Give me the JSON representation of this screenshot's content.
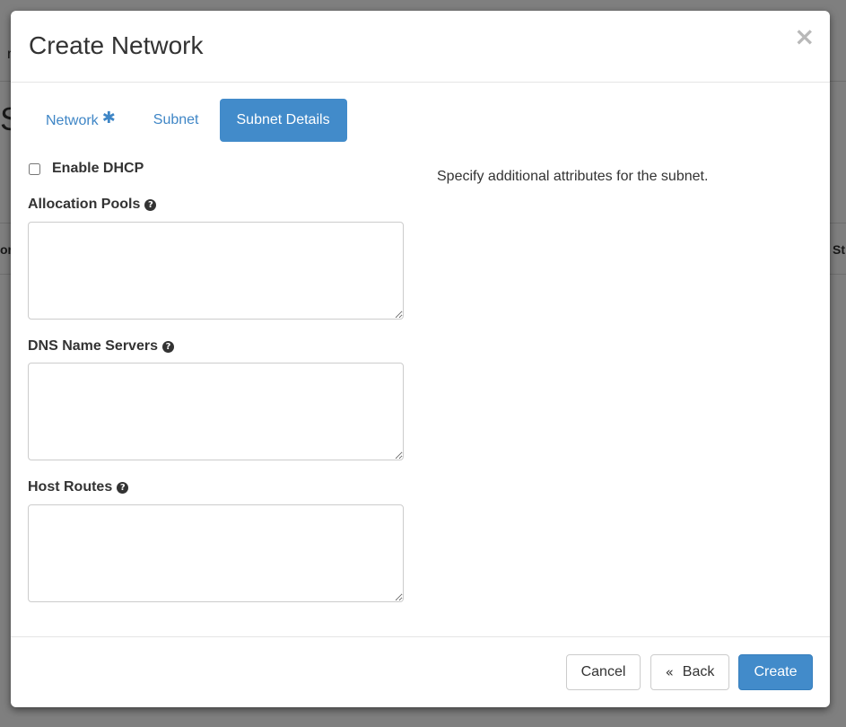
{
  "background": {
    "heading_fragment": "S",
    "nav_fragment": "r",
    "table_col_left_fragment": "or",
    "table_col_right_fragment": "St"
  },
  "modal": {
    "title": "Create Network",
    "close_glyph": "×"
  },
  "tabs": [
    {
      "label": "Network",
      "required_marker": "✱",
      "active": false
    },
    {
      "label": "Subnet",
      "active": false
    },
    {
      "label": "Subnet Details",
      "active": true
    }
  ],
  "form": {
    "enable_dhcp_label": "Enable DHCP",
    "enable_dhcp_checked": false,
    "allocation_pools": {
      "label": "Allocation Pools",
      "value": ""
    },
    "dns_name_servers": {
      "label": "DNS Name Servers",
      "value": ""
    },
    "host_routes": {
      "label": "Host Routes",
      "value": ""
    },
    "help_glyph": "?"
  },
  "help_text": "Specify additional attributes for the subnet.",
  "footer": {
    "cancel_label": "Cancel",
    "back_chevron": "«",
    "back_label": "Back",
    "create_label": "Create"
  },
  "colors": {
    "primary": "#428bca",
    "link": "#3f86c6"
  }
}
